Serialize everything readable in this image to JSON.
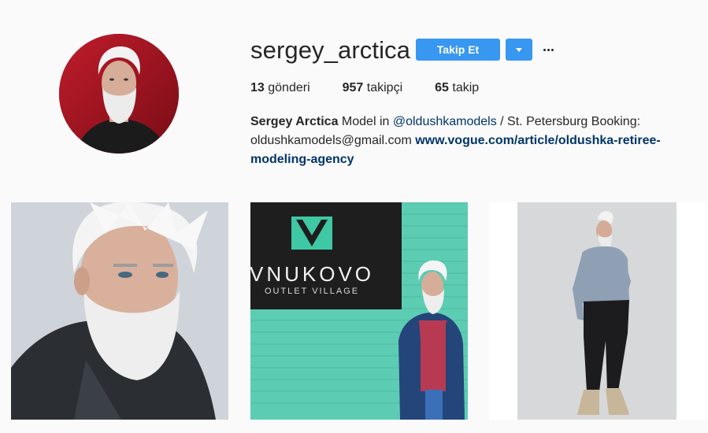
{
  "profile": {
    "username": "sergey_arctica",
    "follow_label": "Takip Et",
    "stats": {
      "posts_count": "13",
      "posts_label": "gönderi",
      "followers_count": "957",
      "followers_label": "takipçi",
      "following_count": "65",
      "following_label": "takip"
    },
    "bio": {
      "full_name": "Sergey Arctica",
      "text_1": " Model in ",
      "mention": "@oldushkamodels",
      "text_2": " / St. Petersburg Booking: oldushkamodels@gmail.com ",
      "website": "www.vogue.com/article/oldushka-retiree-modeling-agency"
    }
  },
  "posts": [
    {
      "kind": "closeup-portrait"
    },
    {
      "kind": "storefront",
      "sign_main": "VNUKOVO",
      "sign_sub": "OUTLET VILLAGE"
    },
    {
      "kind": "full-body"
    }
  ],
  "colors": {
    "accent": "#3897f0",
    "link": "#003569",
    "avatar_bg": "#b0182a",
    "teal_wall": "#5ccdb3"
  },
  "icons": {
    "dropdown": "chevron-down-icon",
    "more": "more-options-icon"
  }
}
